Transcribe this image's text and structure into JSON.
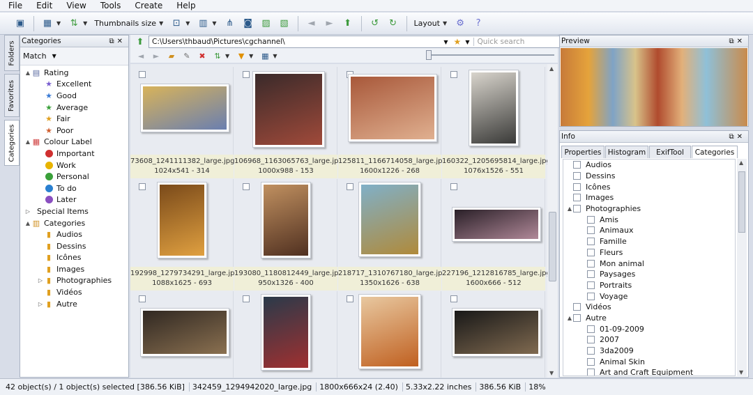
{
  "menu": [
    "File",
    "Edit",
    "View",
    "Tools",
    "Create",
    "Help"
  ],
  "toolbar": {
    "thumbnails_size": "Thumbnails size",
    "layout": "Layout"
  },
  "side_tabs": [
    "Folders",
    "Favorites",
    "Categories"
  ],
  "left": {
    "title": "Categories",
    "match": "Match",
    "tree": [
      {
        "label": "Rating",
        "level": 0,
        "expand": "▲",
        "icon": "rating-icon"
      },
      {
        "label": "Excellent",
        "level": 1,
        "icon": "star-icon",
        "color": "#7a5fd0"
      },
      {
        "label": "Good",
        "level": 1,
        "icon": "star-icon",
        "color": "#3a7bd5"
      },
      {
        "label": "Average",
        "level": 1,
        "icon": "star-icon",
        "color": "#3aa03a"
      },
      {
        "label": "Fair",
        "level": 1,
        "icon": "star-icon",
        "color": "#e0a020"
      },
      {
        "label": "Poor",
        "level": 1,
        "icon": "star-icon",
        "color": "#d06030"
      },
      {
        "label": "Colour Label",
        "level": 0,
        "expand": "▲",
        "icon": "colour-label-icon"
      },
      {
        "label": "Important",
        "level": 1,
        "icon": "dot",
        "color": "#d03030"
      },
      {
        "label": "Work",
        "level": 1,
        "icon": "dot",
        "color": "#e8b400"
      },
      {
        "label": "Personal",
        "level": 1,
        "icon": "dot",
        "color": "#3aa03a"
      },
      {
        "label": "To do",
        "level": 1,
        "icon": "dot",
        "color": "#2a80d0"
      },
      {
        "label": "Later",
        "level": 1,
        "icon": "dot",
        "color": "#8a4fc0"
      },
      {
        "label": "Special Items",
        "level": 0,
        "expand": "▷",
        "icon": ""
      },
      {
        "label": "Categories",
        "level": 0,
        "expand": "▲",
        "icon": "categories-icon"
      },
      {
        "label": "Audios",
        "level": 1,
        "icon": "bookmark-icon"
      },
      {
        "label": "Dessins",
        "level": 1,
        "icon": "bookmark-icon"
      },
      {
        "label": "Icônes",
        "level": 1,
        "icon": "bookmark-icon"
      },
      {
        "label": "Images",
        "level": 1,
        "icon": "bookmark-icon"
      },
      {
        "label": "Photographies",
        "level": 1,
        "expand": "▷",
        "icon": "bookmark-icon"
      },
      {
        "label": "Vidéos",
        "level": 1,
        "icon": "bookmark-icon"
      },
      {
        "label": "Autre",
        "level": 1,
        "expand": "▷",
        "icon": "bookmark-icon"
      }
    ]
  },
  "address": {
    "path": "C:\\Users\\thbaud\\Pictures\\cgchannel\\",
    "search_placeholder": "Quick search"
  },
  "thumbnails": [
    {
      "name": "73608_1241111382_large.jpg",
      "info": "1024x541 - 314",
      "colors": [
        "#d8b35a",
        "#6a7fb0"
      ],
      "shape": "wide"
    },
    {
      "name": "106968_1163065763_large.jpg",
      "info": "1000x988 - 153",
      "colors": [
        "#3a2a2a",
        "#a04a3a"
      ],
      "shape": "square"
    },
    {
      "name": "125811_1166714058_large.jpg",
      "info": "1600x1226 - 268",
      "colors": [
        "#a8583a",
        "#e0b090"
      ],
      "shape": "wide2"
    },
    {
      "name": "160322_1205695814_large.jpg",
      "info": "1076x1526 - 551",
      "colors": [
        "#d8d4cc",
        "#3a3a38"
      ],
      "shape": "tall"
    },
    {
      "name": "192998_1279734291_large.jpg",
      "info": "1088x1625 - 693",
      "colors": [
        "#7a4a1a",
        "#e0a040"
      ],
      "shape": "tall"
    },
    {
      "name": "193080_1180812449_large.jpg",
      "info": "950x1326 - 400",
      "colors": [
        "#c09060",
        "#503020"
      ],
      "shape": "tall"
    },
    {
      "name": "218717_1310767180_large.jpg",
      "info": "1350x1626 - 638",
      "colors": [
        "#80b0c8",
        "#b08a3a"
      ],
      "shape": "tall2"
    },
    {
      "name": "227196_1212816785_large.jpg",
      "info": "1600x666 - 512",
      "colors": [
        "#2a2028",
        "#b08898"
      ],
      "shape": "pano"
    },
    {
      "name": "",
      "info": "",
      "colors": [
        "#302822",
        "#8a7050"
      ],
      "shape": "wide"
    },
    {
      "name": "",
      "info": "",
      "colors": [
        "#2a3a4a",
        "#a03030"
      ],
      "shape": "tall"
    },
    {
      "name": "",
      "info": "",
      "colors": [
        "#e8c8a0",
        "#c06020"
      ],
      "shape": "tall2"
    },
    {
      "name": "",
      "info": "",
      "colors": [
        "#181818",
        "#806a50"
      ],
      "shape": "wide"
    }
  ],
  "right": {
    "preview_title": "Preview",
    "info_title": "Info",
    "tabs": [
      "Properties",
      "Histogram",
      "ExifTool",
      "Categories"
    ],
    "categories": [
      {
        "label": "Audios",
        "indent": 0,
        "expand": ""
      },
      {
        "label": "Dessins",
        "indent": 0,
        "expand": ""
      },
      {
        "label": "Icônes",
        "indent": 0,
        "expand": ""
      },
      {
        "label": "Images",
        "indent": 0,
        "expand": ""
      },
      {
        "label": "Photographies",
        "indent": 0,
        "expand": "▲"
      },
      {
        "label": "Amis",
        "indent": 1,
        "expand": ""
      },
      {
        "label": "Animaux",
        "indent": 1,
        "expand": ""
      },
      {
        "label": "Famille",
        "indent": 1,
        "expand": ""
      },
      {
        "label": "Fleurs",
        "indent": 1,
        "expand": ""
      },
      {
        "label": "Mon animal",
        "indent": 1,
        "expand": ""
      },
      {
        "label": "Paysages",
        "indent": 1,
        "expand": ""
      },
      {
        "label": "Portraits",
        "indent": 1,
        "expand": ""
      },
      {
        "label": "Voyage",
        "indent": 1,
        "expand": ""
      },
      {
        "label": "Vidéos",
        "indent": 0,
        "expand": ""
      },
      {
        "label": "Autre",
        "indent": 0,
        "expand": "▲"
      },
      {
        "label": "01-09-2009",
        "indent": 1,
        "expand": ""
      },
      {
        "label": "2007",
        "indent": 1,
        "expand": ""
      },
      {
        "label": "3da2009",
        "indent": 1,
        "expand": ""
      },
      {
        "label": "Animal Skin",
        "indent": 1,
        "expand": ""
      },
      {
        "label": "Art and Craft Equipment",
        "indent": 1,
        "expand": ""
      }
    ]
  },
  "status": [
    "42 object(s) / 1 object(s) selected [386.56 KiB]",
    "342459_1294942020_large.jpg",
    "1800x666x24 (2.40)",
    "5.33x2.22 inches",
    "386.56 KiB",
    "18%"
  ]
}
